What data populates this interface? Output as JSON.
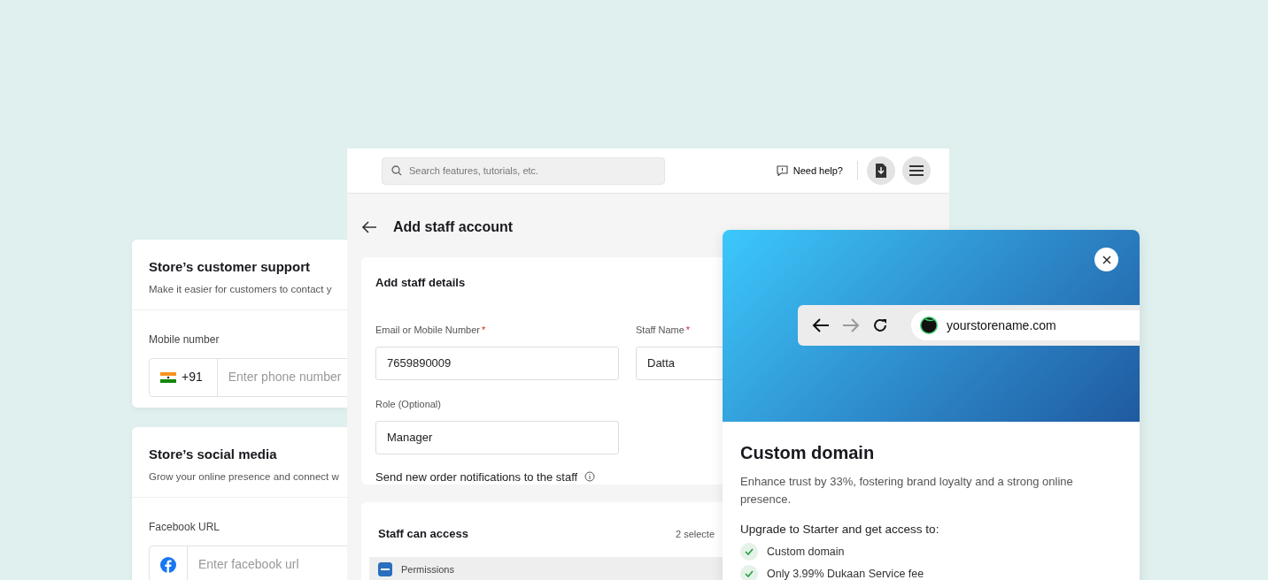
{
  "left_cards": [
    {
      "title": "Store’s customer support",
      "subtitle": "Make it easier for customers to contact y",
      "field_label": "Mobile number",
      "kind": "flag",
      "prefix_text": "+91",
      "placeholder": "Enter phone number"
    },
    {
      "title": "Store’s social media",
      "subtitle": "Grow your online presence and connect w",
      "field_label": "Facebook URL",
      "kind": "facebook",
      "placeholder": "Enter facebook url"
    }
  ],
  "topbar": {
    "search_placeholder": "Search features, tutorials, etc.",
    "help": "Need help?"
  },
  "page_title": "Add staff account",
  "details": {
    "title": "Add staff details",
    "fields": [
      {
        "label": "Email or Mobile Number",
        "required": true,
        "required_mark": "*",
        "value": "7659890009"
      },
      {
        "label": "Staff Name",
        "required": true,
        "required_mark": "*",
        "value": "Datta"
      },
      {
        "label": "Role (Optional)",
        "required": false,
        "value": "Manager"
      }
    ],
    "notification_text": "Send new order notifications to the staff"
  },
  "access": {
    "title": "Staff can access",
    "count": "2 selecte",
    "rows": [
      {
        "label": "Permissions",
        "indeterminate": true
      }
    ]
  },
  "modal": {
    "url": "yourstorename.com",
    "title": "Custom domain",
    "description": "Enhance trust by 33%, fostering brand loyalty and a strong online presence.",
    "upgrade_text": "Upgrade to Starter and get access to:",
    "features": [
      "Custom domain",
      "Only 3.99% Dukaan Service fee"
    ]
  }
}
